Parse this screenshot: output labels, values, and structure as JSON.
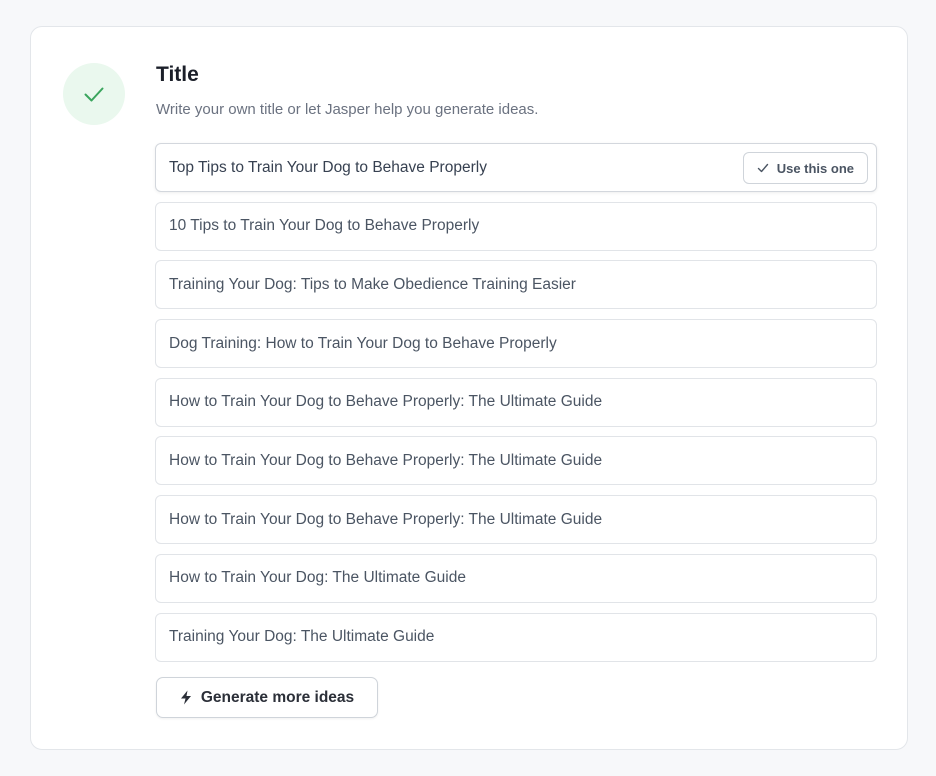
{
  "section": {
    "title": "Title",
    "subtitle": "Write your own title or let Jasper help you generate ideas.",
    "status_icon": "check-icon",
    "accent_color": "#3aa55d"
  },
  "options": [
    {
      "text": "Top Tips to Train Your Dog to Behave Properly",
      "selected": true
    },
    {
      "text": "10 Tips to Train Your Dog to Behave Properly",
      "selected": false
    },
    {
      "text": "Training Your Dog: Tips to Make Obedience Training Easier",
      "selected": false
    },
    {
      "text": "Dog Training: How to Train Your Dog to Behave Properly",
      "selected": false
    },
    {
      "text": "How to Train Your Dog to Behave Properly: The Ultimate Guide",
      "selected": false
    },
    {
      "text": "How to Train Your Dog to Behave Properly: The Ultimate Guide",
      "selected": false
    },
    {
      "text": "How to Train Your Dog to Behave Properly: The Ultimate Guide",
      "selected": false
    },
    {
      "text": "How to Train Your Dog: The Ultimate Guide",
      "selected": false
    },
    {
      "text": "Training Your Dog: The Ultimate Guide",
      "selected": false
    }
  ],
  "use_button": {
    "label": "Use this one",
    "icon": "check-icon"
  },
  "generate_button": {
    "label": "Generate more ideas",
    "icon": "lightning-bolt-icon"
  }
}
